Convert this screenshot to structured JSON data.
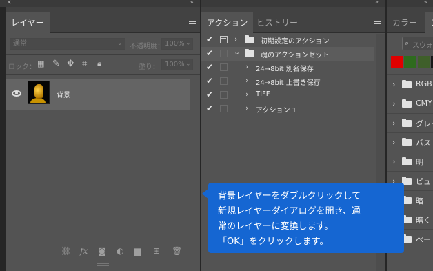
{
  "left_panel": {
    "tab_label": "レイヤー",
    "blend_mode": "通常",
    "opacity_label": "不透明度：",
    "opacity_value": "100%",
    "lock_label": "ロック：",
    "fill_label": "塗り：",
    "fill_value": "100%",
    "layer": {
      "name": "背景"
    },
    "bottom_icons": [
      "link-icon",
      "fx-icon",
      "mask-icon",
      "adjustment-icon",
      "folder-icon",
      "new-layer-icon",
      "trash-icon"
    ]
  },
  "actions_panel": {
    "tabs": [
      {
        "label": "アクション"
      },
      {
        "label": "ヒストリー"
      }
    ],
    "rows": [
      {
        "label": "初期設定のアクション",
        "checked": true,
        "expanded": false,
        "kind": "set"
      },
      {
        "label": "魂のアクションセット",
        "checked": true,
        "expanded": true,
        "kind": "set"
      },
      {
        "label": "24→8bit 別名保存",
        "checked": true,
        "kind": "action"
      },
      {
        "label": "24→8bit 上書き保存",
        "checked": true,
        "kind": "action"
      },
      {
        "label": "TIFF",
        "checked": true,
        "kind": "action"
      },
      {
        "label": "アクション 1",
        "checked": true,
        "kind": "action"
      }
    ]
  },
  "swatches_panel": {
    "tabs": [
      {
        "label": "カラー"
      },
      {
        "label": "ス"
      }
    ],
    "search_placeholder": "スウォッ",
    "colors": [
      "#e00000",
      "#2e6b1e",
      "#3f5f2a",
      "#181818"
    ],
    "groups": [
      {
        "label": "RGB"
      },
      {
        "label": "CMY"
      },
      {
        "label": "グレー"
      },
      {
        "label": "パス"
      },
      {
        "label": "明"
      },
      {
        "label": "ピュ"
      },
      {
        "label": "暗"
      },
      {
        "label": "暗く"
      },
      {
        "label": "ペー"
      }
    ]
  },
  "callout": {
    "lines": [
      "背景レイヤーをダブルクリックして",
      "新規レイヤーダイアログを開き、通",
      "常のレイヤーに変換します。",
      "「OK」をクリックします。"
    ]
  }
}
